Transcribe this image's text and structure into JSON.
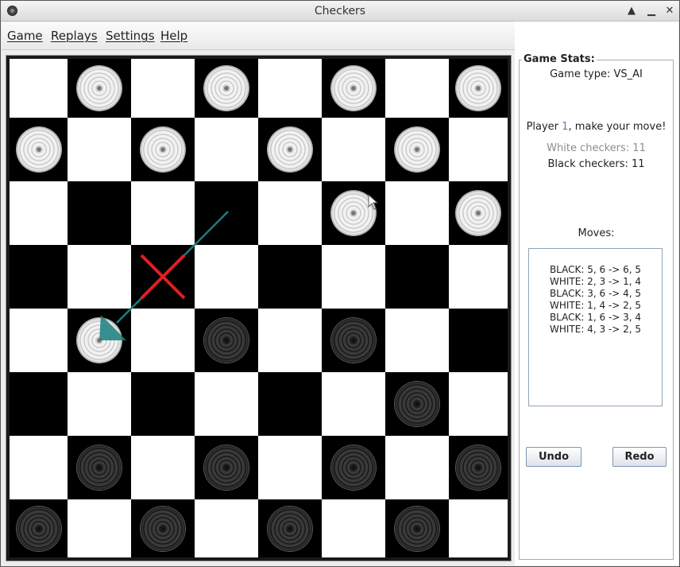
{
  "window": {
    "title": "Checkers"
  },
  "menu": {
    "game": "Game",
    "replays": "Replays",
    "settings": "Settings",
    "help": "Help"
  },
  "stats": {
    "legend": "Game Stats:",
    "game_type": "Game type: VS_AI",
    "player_prefix": "Player ",
    "player_number": "1",
    "player_suffix": ", make your move!",
    "white_count": "White checkers: 11",
    "black_count": "Black checkers: 11",
    "moves_label": "Moves:"
  },
  "moves": [
    "BLACK: 5, 6 -> 6, 5",
    "WHITE: 2, 3 -> 1, 4",
    "BLACK: 3, 6 -> 4, 5",
    "WHITE: 1, 4 -> 2, 5",
    "BLACK: 1, 6 -> 3, 4",
    "WHITE: 4, 3 -> 2, 5"
  ],
  "buttons": {
    "undo": "Undo",
    "redo": "Redo"
  },
  "board": {
    "size": 8,
    "pieces": [
      {
        "color": "white",
        "row": 0,
        "col": 1
      },
      {
        "color": "white",
        "row": 0,
        "col": 3
      },
      {
        "color": "white",
        "row": 0,
        "col": 5
      },
      {
        "color": "white",
        "row": 0,
        "col": 7
      },
      {
        "color": "white",
        "row": 1,
        "col": 0
      },
      {
        "color": "white",
        "row": 1,
        "col": 2
      },
      {
        "color": "white",
        "row": 1,
        "col": 4
      },
      {
        "color": "white",
        "row": 1,
        "col": 6
      },
      {
        "color": "white",
        "row": 2,
        "col": 5
      },
      {
        "color": "white",
        "row": 2,
        "col": 7
      },
      {
        "color": "white",
        "row": 4,
        "col": 1
      },
      {
        "color": "black",
        "row": 4,
        "col": 3
      },
      {
        "color": "black",
        "row": 4,
        "col": 5
      },
      {
        "color": "black",
        "row": 5,
        "col": 6
      },
      {
        "color": "black",
        "row": 6,
        "col": 1
      },
      {
        "color": "black",
        "row": 6,
        "col": 3
      },
      {
        "color": "black",
        "row": 6,
        "col": 5
      },
      {
        "color": "black",
        "row": 6,
        "col": 7
      },
      {
        "color": "black",
        "row": 7,
        "col": 0
      },
      {
        "color": "black",
        "row": 7,
        "col": 2
      },
      {
        "color": "black",
        "row": 7,
        "col": 4
      },
      {
        "color": "black",
        "row": 7,
        "col": 6
      }
    ],
    "last_move": {
      "from_row": 2,
      "from_col": 3,
      "to_row": 4,
      "to_col": 1,
      "captured_row": 3,
      "captured_col": 2
    }
  },
  "colors": {
    "arrow": "#1a7f80",
    "capture_mark": "#e02020",
    "light_square": "#ffffff",
    "dark_square": "#000000"
  }
}
